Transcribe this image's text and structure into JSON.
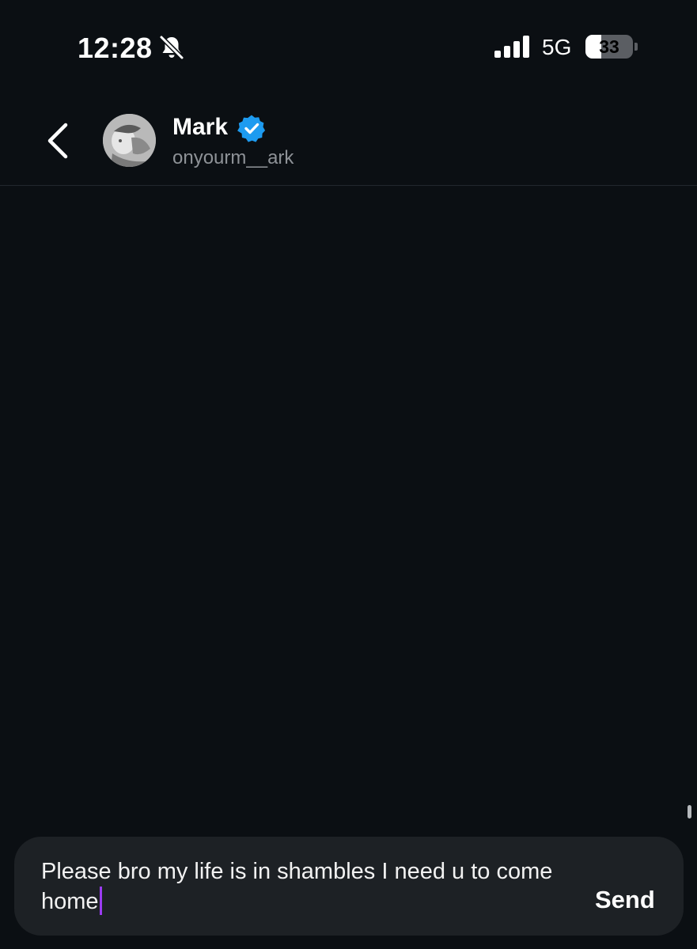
{
  "status_bar": {
    "time": "12:28",
    "bell_icon": "bell-slash-icon",
    "signal_icon": "cellular-signal-icon",
    "network": "5G",
    "battery_level": "33",
    "battery_fraction": 0.33
  },
  "header": {
    "back_icon": "chevron-left-icon",
    "contact_name": "Mark",
    "verified_icon": "verified-badge-icon",
    "verified_color": "#1d9bf0",
    "contact_handle": "onyourm__ark"
  },
  "composer": {
    "message_text": "Please bro my life is in shambles I need u to come home",
    "send_label": "Send",
    "caret_color": "#9b3cf2"
  },
  "theme": {
    "background": "#0b0f13",
    "composer_background": "#1d2125"
  }
}
